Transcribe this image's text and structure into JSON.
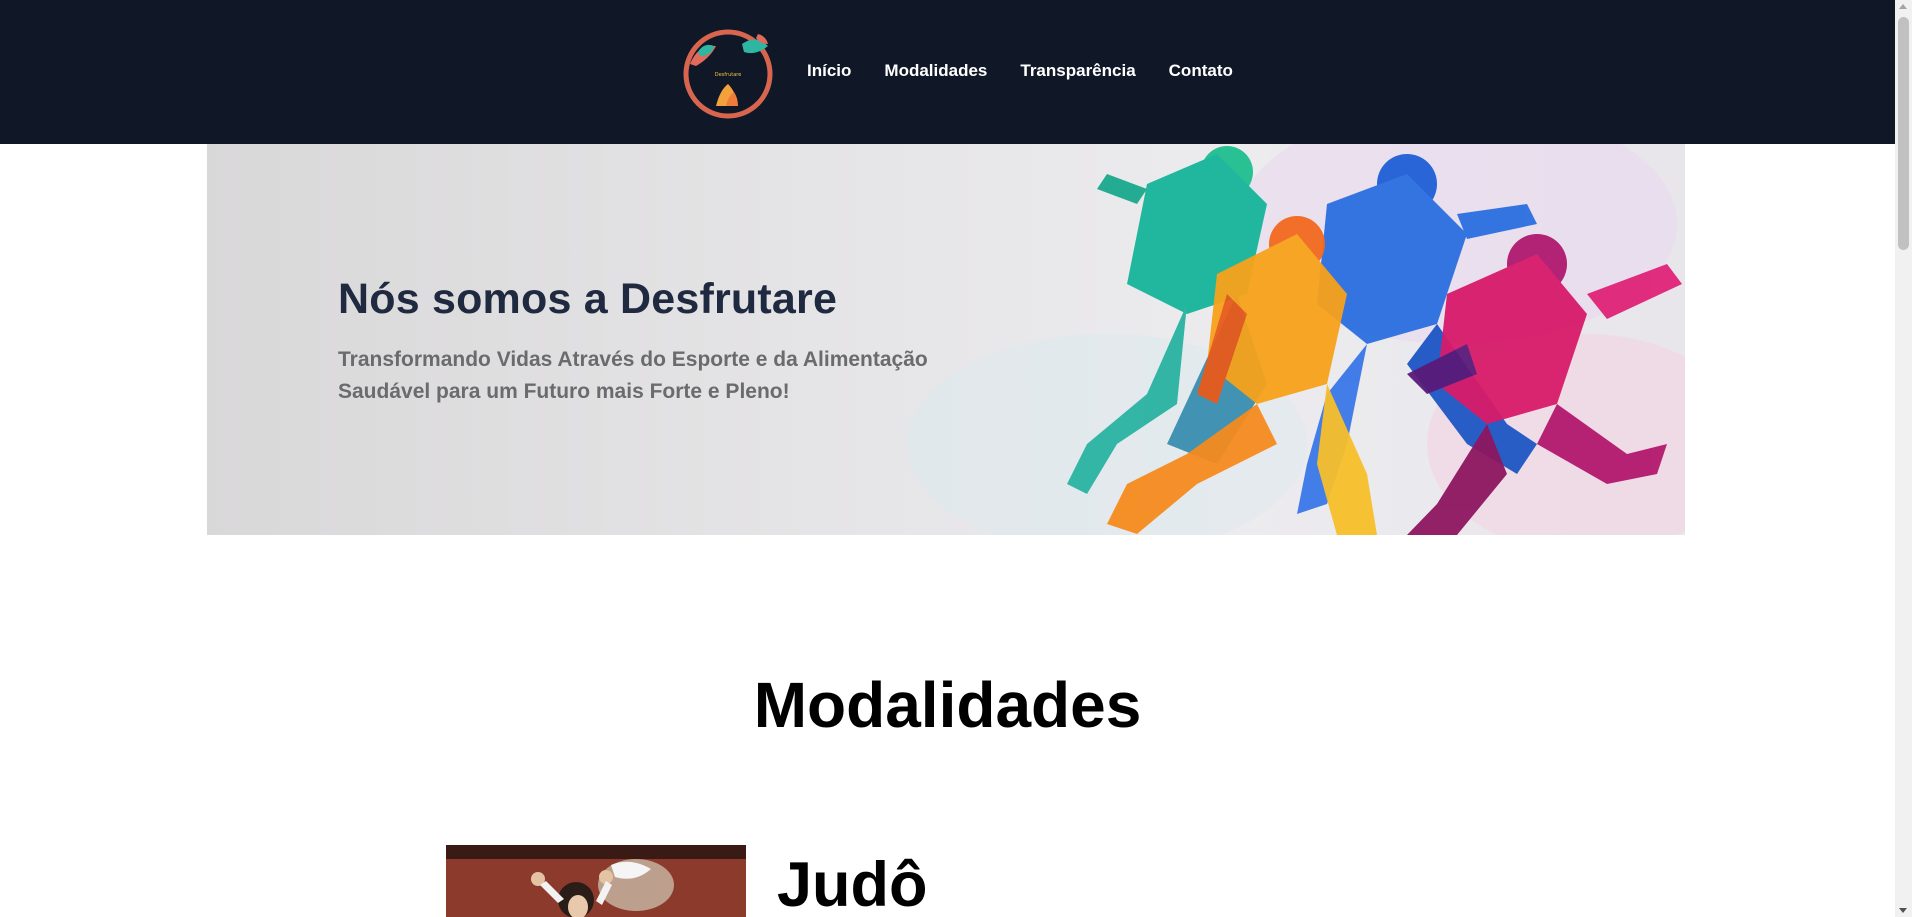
{
  "header": {
    "logo_alt": "Desfrutare",
    "nav": [
      {
        "label": "Início"
      },
      {
        "label": "Modalidades"
      },
      {
        "label": "Transparência"
      },
      {
        "label": "Contato"
      }
    ]
  },
  "hero": {
    "title": "Nós somos a Desfrutare",
    "subtitle": "Transformando Vidas Através do Esporte e da Alimentação Saudável para um Futuro mais Forte e Pleno!"
  },
  "modalities": {
    "title": "Modalidades",
    "items": [
      {
        "title": "Judô"
      }
    ]
  },
  "colors": {
    "header_bg": "#101828",
    "hero_title": "#1f2a40",
    "hero_subtitle": "#6b6b6e"
  }
}
